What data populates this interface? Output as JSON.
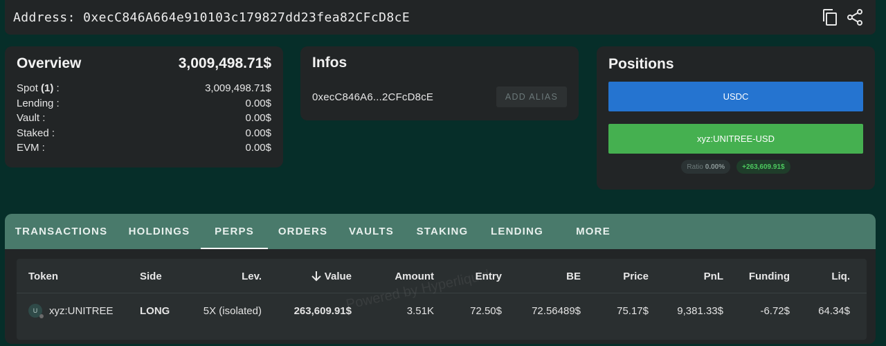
{
  "header": {
    "address_label": "Address: 0xecC846A664e910103c179827dd23fea82CFcD8cE",
    "copy_icon": "copy-icon",
    "share_icon": "share-icon"
  },
  "overview": {
    "title": "Overview",
    "total": "3,009,498.71$",
    "rows": [
      {
        "label": "Spot",
        "count": "(1)",
        "suffix": " :",
        "value": "3,009,498.71$"
      },
      {
        "label": "Lending :",
        "value": "0.00$"
      },
      {
        "label": "Vault :",
        "value": "0.00$"
      },
      {
        "label": "Staked :",
        "value": "0.00$"
      },
      {
        "label": "EVM :",
        "value": "0.00$"
      }
    ]
  },
  "infos": {
    "title": "Infos",
    "short_address": "0xecC846A6...2CFcD8cE",
    "add_alias_label": "ADD ALIAS"
  },
  "positions": {
    "title": "Positions",
    "buttons": [
      {
        "label": "USDC",
        "color": "#2574d0"
      },
      {
        "label": "xyz:UNITREE-USD",
        "color": "#45b050"
      }
    ],
    "ratio_label": "Ratio",
    "ratio_value": "0.00%",
    "pnl": "+263,609.91$"
  },
  "tabs": [
    {
      "label": "TRANSACTIONS",
      "active": false
    },
    {
      "label": "HOLDINGS",
      "active": false
    },
    {
      "label": "PERPS",
      "active": true
    },
    {
      "label": "ORDERS",
      "active": false
    },
    {
      "label": "VAULTS",
      "active": false
    },
    {
      "label": "STAKING",
      "active": false
    },
    {
      "label": "LENDING",
      "active": false
    },
    {
      "label": "MORE",
      "active": false
    }
  ],
  "table": {
    "headers": {
      "token": "Token",
      "side": "Side",
      "lev": "Lev.",
      "value": "Value",
      "amount": "Amount",
      "entry": "Entry",
      "be": "BE",
      "price": "Price",
      "pnl": "PnL",
      "funding": "Funding",
      "liq": "Liq."
    },
    "rows": [
      {
        "token_icon_text": "U",
        "token": "xyz:UNITREE",
        "side": "LONG",
        "lev": "5X (isolated)",
        "value": "263,609.91$",
        "amount": "3.51K",
        "entry": "72.50$",
        "be": "72.56489$",
        "price": "75.17$",
        "pnl": "9,381.33$",
        "funding": "-6.72$",
        "liq": "64.34$"
      }
    ]
  },
  "watermark": "Powered by Hyperliquid",
  "colors": {
    "background": "#062e29",
    "card": "#222526",
    "tab_bar": "#497a6b",
    "long": "#3da645",
    "negative": "#e53935"
  }
}
